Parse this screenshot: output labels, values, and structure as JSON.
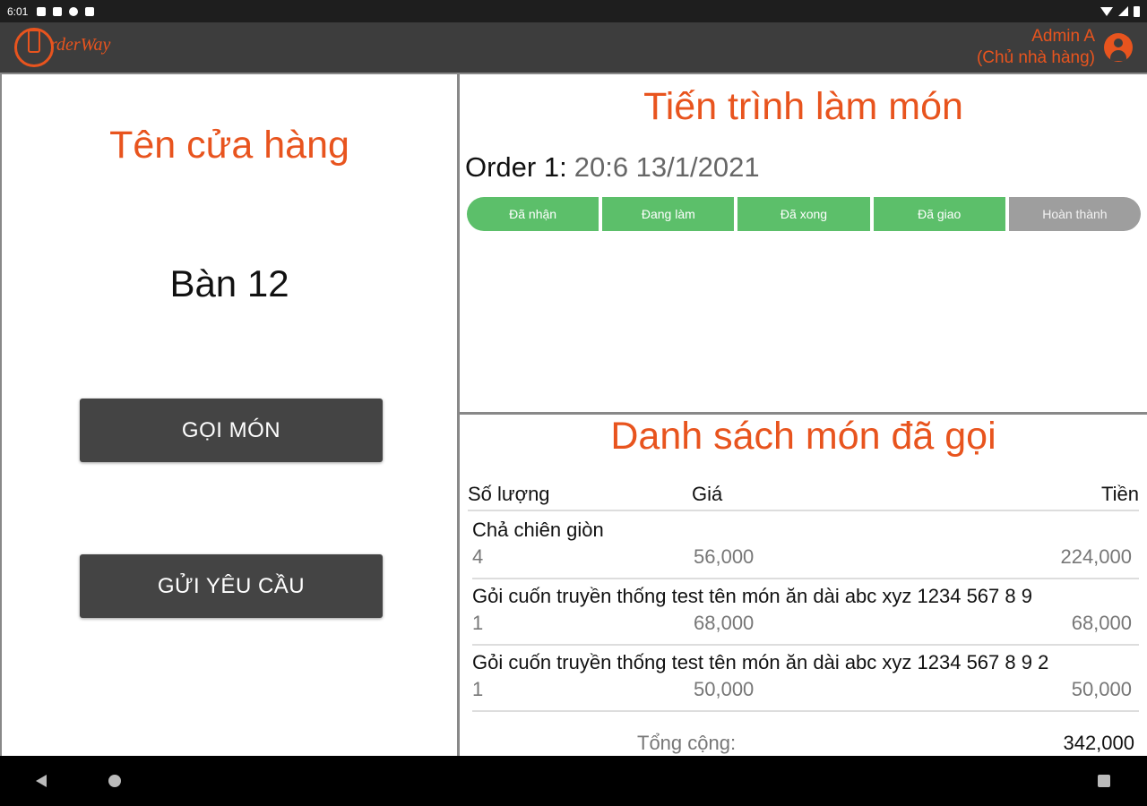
{
  "status_bar": {
    "time": "6:01"
  },
  "app_bar": {
    "brand": "rderWay",
    "user_name": "Admin A",
    "user_role": "(Chủ nhà hàng)"
  },
  "left_panel": {
    "store_name": "Tên cửa hàng",
    "table_name": "Bàn 12",
    "order_button": "GỌI MÓN",
    "request_button": "GỬI YÊU CẦU"
  },
  "progress": {
    "title": "Tiến trình làm món",
    "order_label": "Order 1:",
    "order_time": "20:6 13/1/2021",
    "steps": [
      {
        "label": "Đã nhận",
        "done": true
      },
      {
        "label": "Đang làm",
        "done": true
      },
      {
        "label": "Đã xong",
        "done": true
      },
      {
        "label": "Đã giao",
        "done": true
      },
      {
        "label": "Hoàn thành",
        "done": false
      }
    ],
    "colors": {
      "done": "#5cbf6a",
      "pending": "#9e9e9e"
    }
  },
  "order_list": {
    "title": "Danh sách món đã gọi",
    "headers": {
      "qty": "Số lượng",
      "price": "Giá",
      "total": "Tiền"
    },
    "items": [
      {
        "name": "Chả chiên giòn",
        "qty": "4",
        "price": "56,000",
        "total": "224,000"
      },
      {
        "name": "Gỏi cuốn truyền thống test tên món ăn dài abc xyz 1234 567 8 9",
        "qty": "1",
        "price": "68,000",
        "total": "68,000"
      },
      {
        "name": "Gỏi cuốn truyền thống test tên món ăn dài abc xyz 1234 567 8 9 2",
        "qty": "1",
        "price": "50,000",
        "total": "50,000"
      }
    ],
    "total_label": "Tổng cộng:",
    "total_value": "342,000"
  },
  "theme": {
    "accent": "#e8541e",
    "appbar": "#3d3d3d",
    "button": "#444444"
  }
}
